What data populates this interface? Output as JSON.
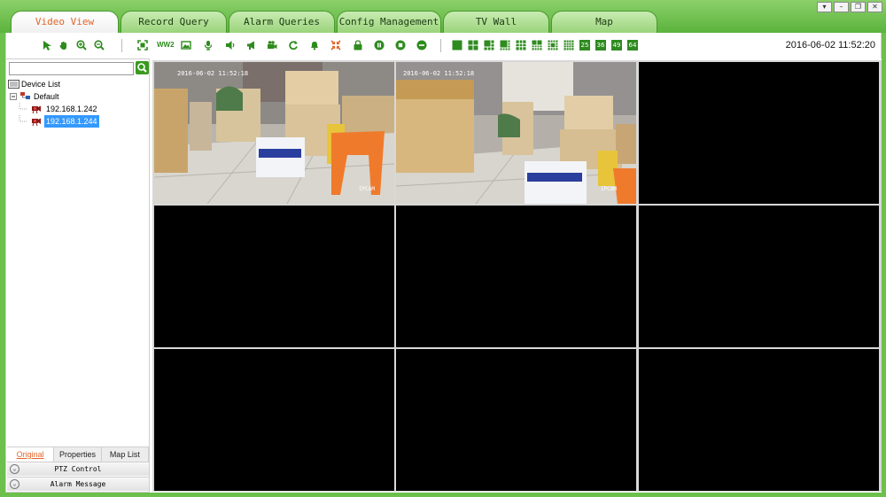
{
  "window": {
    "tabs": [
      {
        "label": "Video View",
        "active": true
      },
      {
        "label": "Record Query",
        "active": false
      },
      {
        "label": "Alarm Queries",
        "active": false
      },
      {
        "label": "Config Management",
        "active": false
      },
      {
        "label": "TV Wall",
        "active": false
      },
      {
        "label": "Map",
        "active": false
      }
    ],
    "controls": [
      "menu-down-icon",
      "minimize-icon",
      "restore-icon",
      "close-icon"
    ],
    "colors": {
      "frame": "#6cc04b",
      "tab_active_text": "#e2662a",
      "selection": "#3399ff",
      "selected_border": "#d9312a"
    }
  },
  "toolbar": {
    "icons": [
      "select-arrow-icon",
      "pan-hand-icon",
      "zoom-in-icon",
      "zoom-out-icon",
      "fullscreen-icon",
      "ww2-icon",
      "snapshot-icon",
      "microphone-icon",
      "speaker-icon",
      "broadcast-icon",
      "record-camera-icon",
      "refresh-icon",
      "alarm-bell-icon",
      "shrink-icon",
      "lock-icon",
      "pause-icon",
      "stop-icon",
      "minus-circle-icon"
    ],
    "ww2_label": "WW2",
    "layouts": [
      "1",
      "4",
      "6",
      "8",
      "9",
      "10",
      "13",
      "16",
      "25",
      "36",
      "49",
      "64"
    ],
    "datetime": "2016-06-02 11:52:20"
  },
  "sidebar": {
    "search_value": "",
    "tree": {
      "root_label": "Device List",
      "group_label": "Default",
      "devices": [
        {
          "label": "192.168.1.242",
          "selected": false
        },
        {
          "label": "192.168.1.244",
          "selected": true
        }
      ]
    },
    "tabs": [
      {
        "label": "Original",
        "active": true
      },
      {
        "label": "Properties",
        "active": false
      },
      {
        "label": "Map List",
        "active": false
      }
    ],
    "accordion": [
      {
        "label": "PTZ Control"
      },
      {
        "label": "Alarm Message"
      }
    ]
  },
  "video_grid": {
    "cells": [
      {
        "timestamp": "2016-06-02 11:52:18",
        "name": "IPCAM",
        "selected": false,
        "live": true
      },
      {
        "timestamp": "2016-06-02 11:52:18",
        "name": "IPCAM",
        "selected": true,
        "live": true
      },
      {
        "timestamp": "",
        "name": "",
        "selected": false,
        "live": false
      },
      {
        "timestamp": "",
        "name": "",
        "selected": false,
        "live": false
      },
      {
        "timestamp": "",
        "name": "",
        "selected": false,
        "live": false
      },
      {
        "timestamp": "",
        "name": "",
        "selected": false,
        "live": false
      },
      {
        "timestamp": "",
        "name": "",
        "selected": false,
        "live": false
      },
      {
        "timestamp": "",
        "name": "",
        "selected": false,
        "live": false
      },
      {
        "timestamp": "",
        "name": "",
        "selected": false,
        "live": false
      }
    ]
  }
}
